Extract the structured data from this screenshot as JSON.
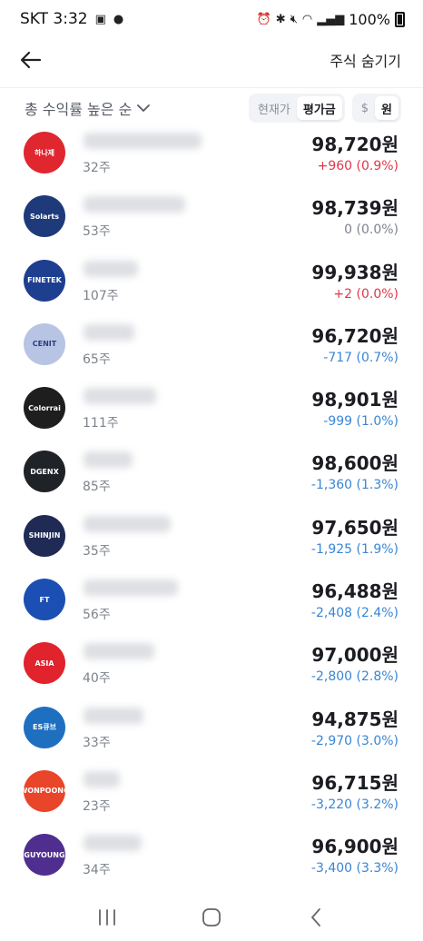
{
  "status_bar": {
    "carrier_time": "SKT 3:32",
    "battery": "100%"
  },
  "header": {
    "hide_label": "주식 숨기기"
  },
  "filter": {
    "sort_label": "총 수익률 높은 순",
    "price_toggle": [
      "현재가",
      "평가금"
    ],
    "price_toggle_active": "평가금",
    "currency_toggle": [
      "$",
      "원"
    ],
    "currency_toggle_active": "원"
  },
  "colors": {
    "up": "#e0374b",
    "down": "#3a85d4",
    "flat": "#7d838d"
  },
  "stocks": [
    {
      "logo_text": "하나제",
      "logo_color": "#e0262f",
      "shares": "32주",
      "value": "98,720원",
      "change": "+960 (0.9%)",
      "direction": "up"
    },
    {
      "logo_text": "Solarts",
      "logo_color": "#1f3a7a",
      "shares": "53주",
      "value": "98,739원",
      "change": "0 (0.0%)",
      "direction": "flat"
    },
    {
      "logo_text": "FINETEK",
      "logo_color": "#1e3f8f",
      "shares": "107주",
      "value": "99,938원",
      "change": "+2 (0.0%)",
      "direction": "up"
    },
    {
      "logo_text": "CENIT",
      "logo_color": "#b7c4e4",
      "shares": "65주",
      "value": "96,720원",
      "change": "-717 (0.7%)",
      "direction": "down"
    },
    {
      "logo_text": "Colorrai",
      "logo_color": "#1e1e1e",
      "shares": "111주",
      "value": "98,901원",
      "change": "-999 (1.0%)",
      "direction": "down"
    },
    {
      "logo_text": "DGENX",
      "logo_color": "#1f2226",
      "shares": "85주",
      "value": "98,600원",
      "change": "-1,360 (1.3%)",
      "direction": "down"
    },
    {
      "logo_text": "SHINJIN",
      "logo_color": "#1f2a55",
      "shares": "35주",
      "value": "97,650원",
      "change": "-1,925 (1.9%)",
      "direction": "down"
    },
    {
      "logo_text": "FT",
      "logo_color": "#1c4fb3",
      "shares": "56주",
      "value": "96,488원",
      "change": "-2,408 (2.4%)",
      "direction": "down"
    },
    {
      "logo_text": "ASIA",
      "logo_color": "#e0232c",
      "shares": "40주",
      "value": "97,000원",
      "change": "-2,800 (2.8%)",
      "direction": "down"
    },
    {
      "logo_text": "ES큐브",
      "logo_color": "#1f6fc1",
      "shares": "33주",
      "value": "94,875원",
      "change": "-2,970 (3.0%)",
      "direction": "down"
    },
    {
      "logo_text": "WONPOONG",
      "logo_color": "#e8452a",
      "shares": "23주",
      "value": "96,715원",
      "change": "-3,220 (3.2%)",
      "direction": "down"
    },
    {
      "logo_text": "GUYOUNG",
      "logo_color": "#4f2e8f",
      "shares": "34주",
      "value": "96,900원",
      "change": "-3,400 (3.3%)",
      "direction": "down"
    }
  ],
  "icons": {
    "back": "back-arrow-icon",
    "sort": "chevron-down-icon",
    "nav": [
      "recent-apps-icon",
      "home-icon",
      "back-nav-icon"
    ]
  }
}
